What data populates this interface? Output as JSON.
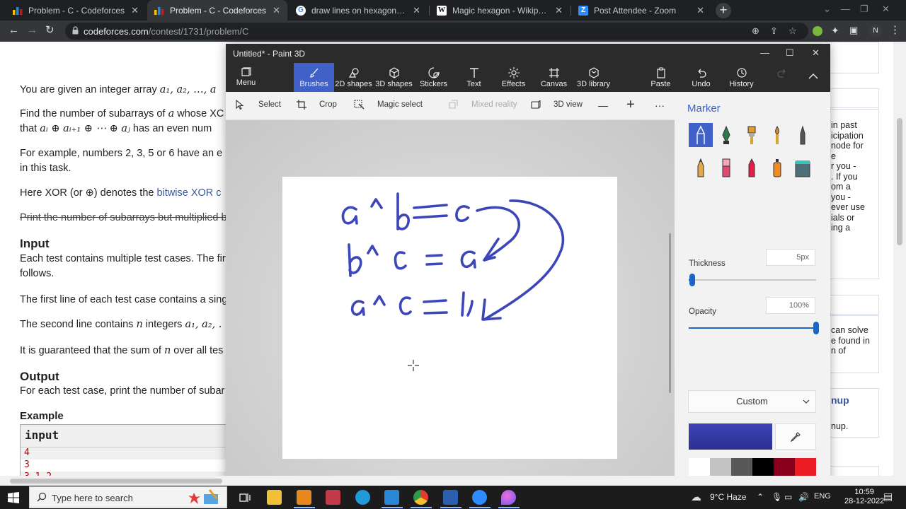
{
  "browser": {
    "tabs": [
      {
        "title": "Problem - C - Codeforces",
        "icon": "codeforces-icon",
        "active": false
      },
      {
        "title": "Problem - C - Codeforces",
        "icon": "codeforces-icon",
        "active": true
      },
      {
        "title": "draw lines on hexagonal cells - G",
        "icon": "google-icon",
        "active": false
      },
      {
        "title": "Magic hexagon - Wikipedia",
        "icon": "wikipedia-icon",
        "active": false
      },
      {
        "title": "Post Attendee - Zoom",
        "icon": "zoom-icon",
        "active": false
      }
    ],
    "url_domain": "codeforces.com",
    "url_path": "/contest/1731/problem/C",
    "profile_initial": "N"
  },
  "problem": {
    "p1": "You are given an integer array ",
    "p1_math": "a₁, a₂, …, a",
    "p2": "Find the number of subarrays of ",
    "p2_math": "a",
    "p2_b": " whose XC",
    "p3": "that ",
    "p3_math": "aᵢ ⊕ aᵢ₊₁ ⊕ ⋯ ⊕ aⱼ",
    "p3_b": " has an even num",
    "p4": "For example, numbers 2, 3, 5 or 6 have an e",
    "p5": "in this task.",
    "p6_a": "Here XOR (or ⊕) denotes the ",
    "p6_link": "bitwise XOR c",
    "p7": "Print the number of subarrays but multiplied b",
    "input_heading": "Input",
    "input1": "Each test contains multiple test cases. The fir",
    "input2": "follows.",
    "input3": "The first line of each test case contains a sing",
    "input4_a": "The second line contains ",
    "input4_math": "n",
    "input4_b": " integers ",
    "input4_math2": "a₁, a₂, .",
    "input5": "It is guaranteed that the sum of ",
    "input5_math": "n",
    "input5_b": " over all tes",
    "output_heading": "Output",
    "output1": "For each test case, print the number of subar",
    "example_heading": "Example",
    "example_input_label": "input",
    "example_rows": [
      "4",
      "3",
      "3 1 2"
    ]
  },
  "right_column": {
    "box1_lines": [
      "in past",
      "icipation",
      "node for",
      "e",
      "r you -",
      ". If you",
      "om a",
      "you -",
      "ever use",
      "ials or",
      "ing a"
    ],
    "box2_lines": [
      "can solve",
      "e found in",
      "n of"
    ],
    "box3_title": "nup",
    "box3_text": "nup."
  },
  "paint3d": {
    "title": "Untitled* - Paint 3D",
    "ribbon": [
      {
        "label": "Menu",
        "icon": "menu-icon"
      },
      {
        "label": "Brushes",
        "icon": "brush-icon"
      },
      {
        "label": "2D shapes",
        "icon": "2d-shapes-icon"
      },
      {
        "label": "3D shapes",
        "icon": "3d-shapes-icon"
      },
      {
        "label": "Stickers",
        "icon": "stickers-icon"
      },
      {
        "label": "Text",
        "icon": "text-icon"
      },
      {
        "label": "Effects",
        "icon": "effects-icon"
      },
      {
        "label": "Canvas",
        "icon": "canvas-icon"
      },
      {
        "label": "3D library",
        "icon": "3d-library-icon"
      },
      {
        "label": "Paste",
        "icon": "paste-icon"
      },
      {
        "label": "Undo",
        "icon": "undo-icon"
      },
      {
        "label": "History",
        "icon": "history-icon"
      }
    ],
    "subtoolbar": {
      "select": "Select",
      "crop": "Crop",
      "magic_select": "Magic select",
      "mixed_reality": "Mixed reality",
      "view_3d": "3D view",
      "zoom_out": "—",
      "zoom_in": "+",
      "more": "···"
    },
    "panel": {
      "title": "Marker",
      "thickness_label": "Thickness",
      "thickness_value": "5px",
      "thickness_level": 0.03,
      "opacity_label": "Opacity",
      "opacity_value": "100%",
      "opacity_level": 1.0,
      "texture": "Custom",
      "current_color": "#3c46b8",
      "brushes": [
        "marker-icon",
        "calligraphy-pen-icon",
        "oil-brush-icon",
        "watercolor-icon",
        "pixel-pen-icon",
        "pencil-icon",
        "eraser-icon",
        "crayon-icon",
        "spray-can-icon",
        "fill-icon"
      ],
      "palette": [
        "#ffffff",
        "#c3c3c3",
        "#585858",
        "#000000",
        "#88001b",
        "#ec1c24",
        "#ff7f27",
        "#ffca18",
        "#fdeca6",
        "#fff200",
        "#c4ff0e",
        "#0ed145",
        "#8cfffb",
        "#00a8f3",
        "#3f48cc",
        "#b83dba",
        "#ffaec8",
        "#b97a56"
      ]
    }
  },
  "taskbar": {
    "search_placeholder": "Type here to search",
    "weather": "9°C  Haze",
    "language": "ENG",
    "time": "10:59",
    "date": "28-12-2022"
  }
}
